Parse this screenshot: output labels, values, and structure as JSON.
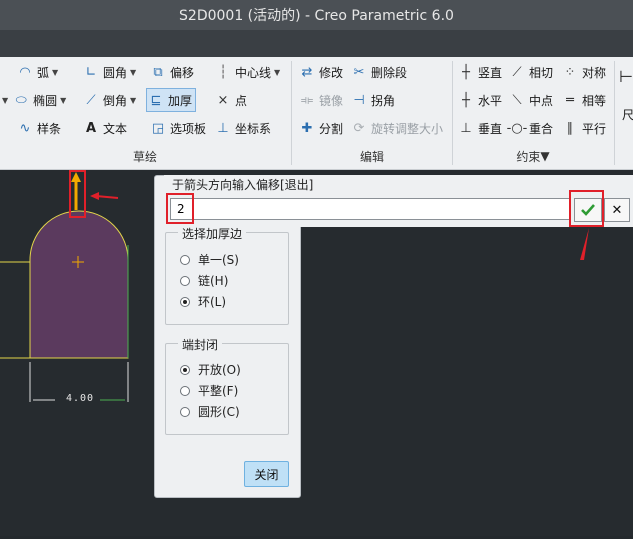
{
  "window": {
    "title": "S2D0001 (活动的) - Creo Parametric 6.0"
  },
  "ribbon": {
    "sketch": {
      "label": "草绘",
      "arc": "弧",
      "fillet": "圆角",
      "offset": "偏移",
      "centerline": "中心线",
      "ellipse": "椭圆",
      "chamfer": "倒角",
      "thicken": "加厚",
      "point": "点",
      "spline": "样条",
      "text": "文本",
      "palette": "选项板",
      "coordsys": "坐标系"
    },
    "edit": {
      "label": "编辑",
      "modify": "修改",
      "delete_segment": "删除段",
      "mirror": "镜像",
      "corner": "拐角",
      "divide": "分割",
      "rotate_resize": "旋转调整大小"
    },
    "constrain": {
      "label": "约束",
      "vertical": "竖直",
      "tangent": "相切",
      "symmetric": "对称",
      "horizontal": "水平",
      "midpoint": "中点",
      "equal": "相等",
      "perpendicular": "垂直",
      "coincident": "重合",
      "parallel": "平行"
    },
    "partial_label": "尺"
  },
  "prompt": {
    "text": "于箭头方向输入偏移[退出]",
    "value": "2"
  },
  "dialog": {
    "select_group_title": "选择加厚边",
    "select_options": [
      {
        "label": "单一(S)",
        "selected": false
      },
      {
        "label": "链(H)",
        "selected": false
      },
      {
        "label": "环(L)",
        "selected": true
      }
    ],
    "end_group_title": "端封闭",
    "end_options": [
      {
        "label": "开放(O)",
        "selected": true
      },
      {
        "label": "平整(F)",
        "selected": false
      },
      {
        "label": "圆形(C)",
        "selected": false
      }
    ],
    "close_label": "关闭"
  },
  "sketch": {
    "dimension": "4.00",
    "shape_fill": "#5b3a5e",
    "arrow_color": "#f2a900",
    "annotation_color": "#e0202a"
  }
}
